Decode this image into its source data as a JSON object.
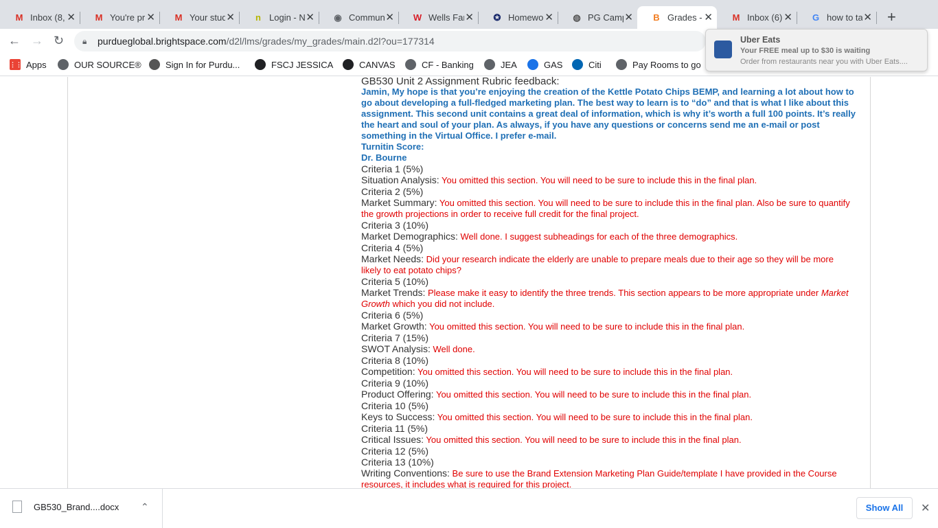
{
  "browser": {
    "tabs": [
      {
        "title": "Inbox (8,",
        "icon": "gmail-icon",
        "glyph": "M",
        "color": "#d93025"
      },
      {
        "title": "You're pr",
        "icon": "gmail-icon",
        "glyph": "M",
        "color": "#d93025"
      },
      {
        "title": "Your stud",
        "icon": "gmail-icon",
        "glyph": "M",
        "color": "#d93025"
      },
      {
        "title": "Login - N",
        "icon": "login-icon",
        "glyph": "n",
        "color": "#b5b500"
      },
      {
        "title": "Commun",
        "icon": "globe-icon",
        "glyph": "◉",
        "color": "#5f6368"
      },
      {
        "title": "Wells Far",
        "icon": "wells-fargo-icon",
        "glyph": "W",
        "color": "#d71e28"
      },
      {
        "title": "Homewo",
        "icon": "homework-icon",
        "glyph": "✪",
        "color": "#1a2a6c"
      },
      {
        "title": "PG Camp",
        "icon": "purdue-icon",
        "glyph": "◍",
        "color": "#555"
      },
      {
        "title": "Grades -",
        "icon": "brightspace-icon",
        "glyph": "B",
        "color": "#f27d21",
        "active": true
      },
      {
        "title": "Inbox (6)",
        "icon": "gmail-icon",
        "glyph": "M",
        "color": "#d93025"
      },
      {
        "title": "how to ta",
        "icon": "google-icon",
        "glyph": "G",
        "color": "#4285f4"
      }
    ],
    "url_host": "purdueglobal.brightspace.com",
    "url_path": "/d2l/lms/grades/my_grades/main.d2l?ou=177314",
    "bookmarks": [
      {
        "label": "Apps",
        "icon": "apps-grid-icon",
        "color": "#ea4335"
      },
      {
        "label": "OUR SOURCE®",
        "icon": "globe-icon",
        "color": "#5f6368"
      },
      {
        "label": "Sign In for Purdu...",
        "icon": "purdue-icon",
        "color": "#555"
      },
      {
        "label": "FSCJ JESSICA",
        "icon": "fscj-icon",
        "color": "#202124"
      },
      {
        "label": "CANVAS",
        "icon": "canvas-icon",
        "color": "#202124"
      },
      {
        "label": "CF - Banking",
        "icon": "globe-icon",
        "color": "#5f6368"
      },
      {
        "label": "JEA",
        "icon": "globe-icon",
        "color": "#5f6368"
      },
      {
        "label": "GAS",
        "icon": "gas-icon",
        "color": "#1a73e8"
      },
      {
        "label": "Citi",
        "icon": "citi-icon",
        "color": "#0066b3"
      },
      {
        "label": "Pay Rooms to go",
        "icon": "globe-icon",
        "color": "#5f6368"
      }
    ]
  },
  "notification": {
    "title": "Uber Eats",
    "line1": "Your FREE meal up to $30 is waiting",
    "line2": "Order from restaurants near you with Uber Eats...."
  },
  "feedback": {
    "heading": "GB530 Unit 2 Assignment Rubric feedback:",
    "intro": "Jamin, My hope is that you’re enjoying the creation of the Kettle Potato Chips BEMP, and learning a lot about how to go about developing a full-fledged marketing plan.  The best way to learn is to “do” and that is what I like about this assignment.  This second unit contains a great deal of information, which is why it’s worth a full 100 points.  It’s really the heart and soul of your plan. As always, if you have any questions or concerns send me an e-mail or post something in the Virtual Office.  I prefer e-mail.",
    "turnitin": "Turnitin Score:",
    "signature": "Dr. Bourne",
    "items": [
      {
        "criteria": "Criteria 1 (5%)",
        "section": "Situation Analysis:",
        "comment": "You omitted this section. You will need to be sure to include this in the final plan."
      },
      {
        "criteria": "Criteria 2 (5%)",
        "section": "Market Summary:",
        "comment": "You omitted this section. You will need to be sure to include this in the final plan. Also be sure to quantify the growth projections in order to receive full credit for the final project."
      },
      {
        "criteria": "Criteria 3 (10%)",
        "section": "Market Demographics:",
        "comment": "Well done. I suggest subheadings for each of the three demographics."
      },
      {
        "criteria": "Criteria 4 (5%)",
        "section": "Market Needs:",
        "comment": "Did your research indicate the elderly are unable to prepare meals due to their age so they will be more likely to eat potato chips?"
      },
      {
        "criteria": "Criteria 5 (10%)",
        "section": "Market Trends:",
        "comment": "Please make it easy to identify the three trends. This section appears to be more appropriate under",
        "comment_italic": "Market Growth",
        "comment_tail": "which you did not include."
      },
      {
        "criteria": "Criteria 6 (5%)",
        "section": "Market Growth:",
        "comment": "You omitted this section. You will need to be sure to include this in the final plan."
      },
      {
        "criteria": "Criteria 7 (15%)",
        "section": "SWOT Analysis:",
        "comment": "Well done."
      },
      {
        "criteria": "Criteria 8 (10%)",
        "section": "Competition:",
        "comment": "You omitted this section. You will need to be sure to include this in the final plan."
      },
      {
        "criteria": "Criteria 9 (10%)",
        "section": "Product Offering:",
        "comment": "You omitted this section. You will need to be sure to include this in the final plan."
      },
      {
        "criteria": "Criteria 10 (5%)",
        "section": "Keys to Success:",
        "comment": "You omitted this section. You will need to be sure to include this in the final plan."
      },
      {
        "criteria": "Criteria 11 (5%)",
        "section": "Critical Issues:",
        "comment": "You omitted this section. You will need to be sure to include this in the final plan."
      },
      {
        "criteria": "Criteria 12 (5%)",
        "section": "",
        "comment": ""
      },
      {
        "criteria": "Criteria 13 (10%)",
        "section": "Writing Conventions:",
        "comment": "Be sure to use the Brand Extension Marketing Plan Guide/template I have provided in the Course resources, it includes what is required for this project."
      }
    ]
  },
  "downloads": {
    "filename": "GB530_Brand....docx",
    "show_all": "Show All"
  }
}
